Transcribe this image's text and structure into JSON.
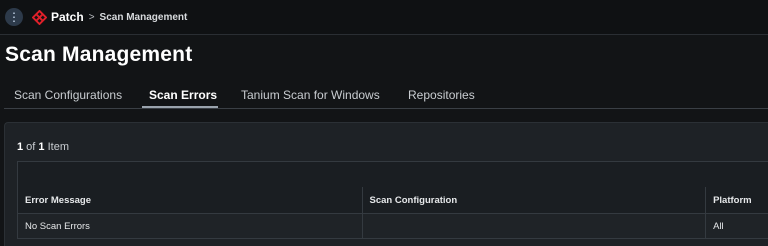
{
  "topbar": {
    "app_name": "Patch",
    "breadcrumb_separator": ">",
    "breadcrumb_current": "Scan Management",
    "menu_icon": "vertical-dots-icon",
    "logo_icon": "patch-logo-icon",
    "brand_color": "#e0202a"
  },
  "page": {
    "title": "Scan Management"
  },
  "tabs": [
    {
      "label": "Scan Configurations",
      "active": false
    },
    {
      "label": "Scan Errors",
      "active": true
    },
    {
      "label": "Tanium Scan for Windows",
      "active": false
    },
    {
      "label": "Repositories",
      "active": false
    }
  ],
  "panel": {
    "count": {
      "current": "1",
      "of": " of ",
      "total": "1",
      "suffix": " Item"
    }
  },
  "table": {
    "columns": [
      "Error Message",
      "Scan Configuration",
      "Platform"
    ],
    "rows": [
      [
        "No Scan Errors",
        "",
        "All"
      ]
    ]
  }
}
